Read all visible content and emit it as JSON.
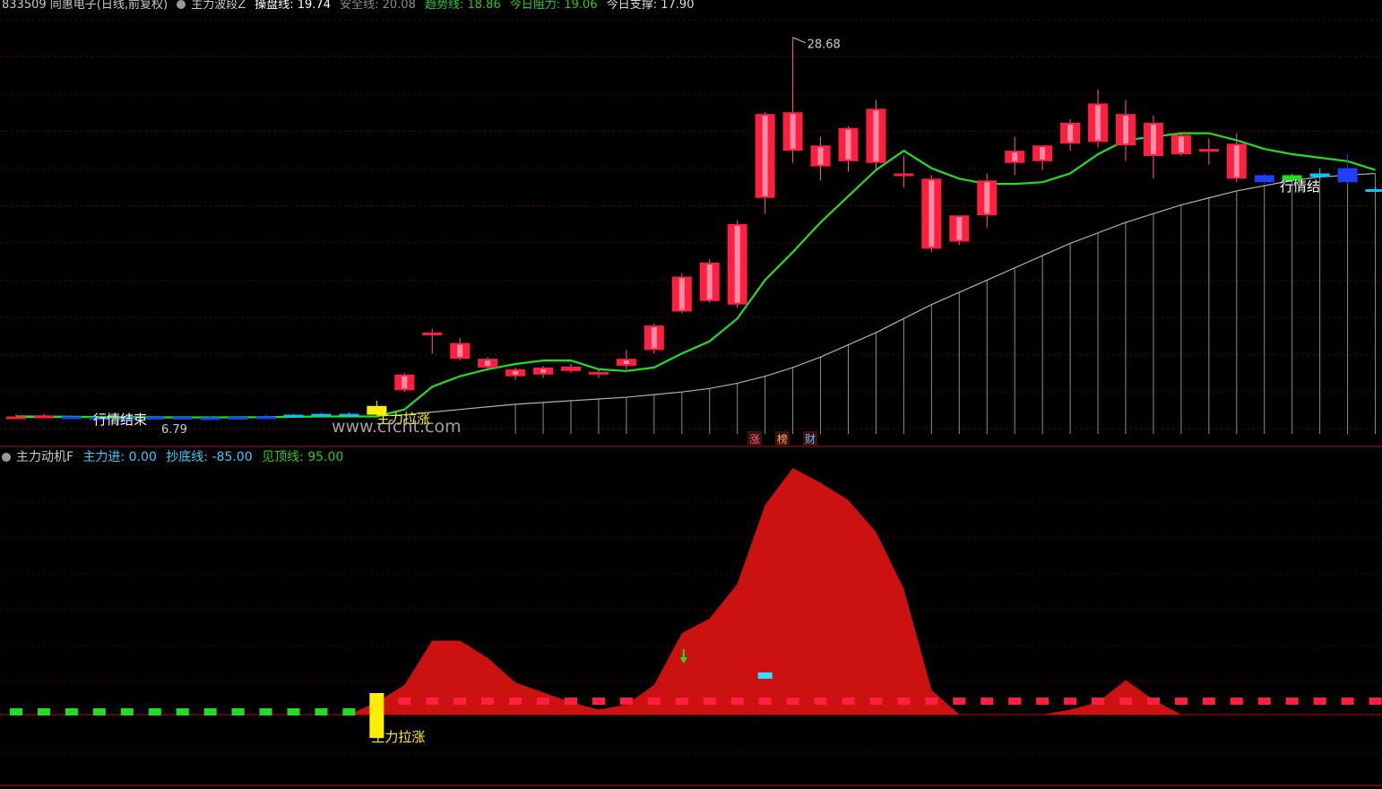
{
  "header": {
    "stock": "833509 同惠电子(日线,前复权)",
    "indicator": "主力波段Z",
    "items": [
      {
        "label": "操盘线: 19.74",
        "color": "#ffffff"
      },
      {
        "label": "安全线: 20.08",
        "color": "#8a8a8a"
      },
      {
        "label": "趋势线: 18.86",
        "color": "#22cc22"
      },
      {
        "label": "今日阻力: 19.06",
        "color": "#22cc22"
      },
      {
        "label": "今日支撑: 17.90",
        "color": "#dddddd"
      }
    ]
  },
  "sub_header": {
    "indicator": "主力动机F",
    "items": [
      {
        "label": "主力进: 0.00",
        "color": "#33ccff"
      },
      {
        "label": "抄底线: -85.00",
        "color": "#33ccff"
      },
      {
        "label": "见顶线: 95.00",
        "color": "#22cc22"
      }
    ]
  },
  "watermark": "www.cfcht.com",
  "colors": {
    "up": "#ff1f3f",
    "down": "#00d0ff",
    "trend": "#22dd22",
    "safe": "#b0b0b0",
    "fill": "#cc1111"
  },
  "chart_data": [
    {
      "type": "candlestick",
      "ylim": [
        6.0,
        30.0
      ],
      "high_label": "28.68",
      "low_label": "6.79",
      "annotations": [
        "行情结束",
        "主力拉涨",
        "行情结",
        "涨",
        "榜",
        "财"
      ],
      "candles": [
        {
          "o": 6.95,
          "h": 7.1,
          "l": 6.85,
          "c": 7.0,
          "col": "red"
        },
        {
          "o": 7.0,
          "h": 7.15,
          "l": 6.9,
          "c": 7.05,
          "col": "red"
        },
        {
          "o": 7.0,
          "h": 7.1,
          "l": 6.9,
          "c": 6.95,
          "col": "blue"
        },
        {
          "o": 6.95,
          "h": 7.05,
          "l": 6.85,
          "c": 6.92,
          "col": "blue"
        },
        {
          "o": 6.92,
          "h": 7.0,
          "l": 6.85,
          "c": 6.95,
          "col": "blue"
        },
        {
          "o": 6.95,
          "h": 7.05,
          "l": 6.88,
          "c": 6.97,
          "col": "blue"
        },
        {
          "o": 6.97,
          "h": 7.05,
          "l": 6.9,
          "c": 6.92,
          "col": "blue"
        },
        {
          "o": 6.92,
          "h": 7.0,
          "l": 6.85,
          "c": 6.95,
          "col": "blue"
        },
        {
          "o": 6.95,
          "h": 7.05,
          "l": 6.88,
          "c": 6.97,
          "col": "blue"
        },
        {
          "o": 6.97,
          "h": 7.1,
          "l": 6.9,
          "c": 7.0,
          "col": "blue"
        },
        {
          "o": 6.95,
          "h": 7.15,
          "l": 6.9,
          "c": 7.1,
          "col": "cyan"
        },
        {
          "o": 7.0,
          "h": 7.2,
          "l": 6.95,
          "c": 7.15,
          "col": "cyan"
        },
        {
          "o": 7.05,
          "h": 7.25,
          "l": 7.0,
          "c": 7.15,
          "col": "cyan"
        },
        {
          "o": 7.1,
          "h": 7.9,
          "l": 7.05,
          "c": 7.6,
          "col": "yellow"
        },
        {
          "o": 8.5,
          "h": 9.5,
          "l": 8.4,
          "c": 9.4,
          "col": "red"
        },
        {
          "o": 11.8,
          "h": 12.0,
          "l": 10.6,
          "c": 11.7,
          "col": "red"
        },
        {
          "o": 10.3,
          "h": 11.5,
          "l": 10.2,
          "c": 11.2,
          "col": "red"
        },
        {
          "o": 9.8,
          "h": 10.4,
          "l": 9.6,
          "c": 10.3,
          "col": "red"
        },
        {
          "o": 9.3,
          "h": 9.8,
          "l": 9.1,
          "c": 9.7,
          "col": "red"
        },
        {
          "o": 9.4,
          "h": 9.9,
          "l": 9.2,
          "c": 9.8,
          "col": "red"
        },
        {
          "o": 9.6,
          "h": 10.0,
          "l": 9.5,
          "c": 9.85,
          "col": "red"
        },
        {
          "o": 9.5,
          "h": 9.7,
          "l": 9.2,
          "c": 9.55,
          "col": "red"
        },
        {
          "o": 9.9,
          "h": 10.8,
          "l": 9.7,
          "c": 10.3,
          "col": "red"
        },
        {
          "o": 10.8,
          "h": 12.3,
          "l": 10.6,
          "c": 12.2,
          "col": "red"
        },
        {
          "o": 13.0,
          "h": 15.2,
          "l": 12.9,
          "c": 15.0,
          "col": "red"
        },
        {
          "o": 13.6,
          "h": 16.0,
          "l": 13.5,
          "c": 15.8,
          "col": "red"
        },
        {
          "o": 13.4,
          "h": 18.2,
          "l": 13.2,
          "c": 18.0,
          "col": "red"
        },
        {
          "o": 19.5,
          "h": 24.4,
          "l": 18.6,
          "c": 24.3,
          "col": "red"
        },
        {
          "o": 22.2,
          "h": 28.68,
          "l": 21.5,
          "c": 24.4,
          "col": "red"
        },
        {
          "o": 21.3,
          "h": 23.0,
          "l": 20.5,
          "c": 22.5,
          "col": "red"
        },
        {
          "o": 21.6,
          "h": 23.6,
          "l": 21.0,
          "c": 23.5,
          "col": "red"
        },
        {
          "o": 21.5,
          "h": 25.1,
          "l": 21.1,
          "c": 24.6,
          "col": "red"
        },
        {
          "o": 20.8,
          "h": 21.9,
          "l": 20.1,
          "c": 20.9,
          "col": "red"
        },
        {
          "o": 16.6,
          "h": 20.8,
          "l": 16.4,
          "c": 20.6,
          "col": "red"
        },
        {
          "o": 17.0,
          "h": 18.5,
          "l": 16.8,
          "c": 18.5,
          "col": "red"
        },
        {
          "o": 18.5,
          "h": 20.9,
          "l": 17.8,
          "c": 20.5,
          "col": "red"
        },
        {
          "o": 21.5,
          "h": 23.0,
          "l": 20.8,
          "c": 22.2,
          "col": "red"
        },
        {
          "o": 21.6,
          "h": 22.5,
          "l": 21.1,
          "c": 22.5,
          "col": "red"
        },
        {
          "o": 22.6,
          "h": 24.0,
          "l": 22.2,
          "c": 23.8,
          "col": "red"
        },
        {
          "o": 22.7,
          "h": 25.7,
          "l": 22.4,
          "c": 24.9,
          "col": "red"
        },
        {
          "o": 22.5,
          "h": 25.1,
          "l": 21.6,
          "c": 24.3,
          "col": "red"
        },
        {
          "o": 21.9,
          "h": 24.2,
          "l": 20.6,
          "c": 23.8,
          "col": "red"
        },
        {
          "o": 22.0,
          "h": 23.2,
          "l": 21.9,
          "c": 23.1,
          "col": "red"
        },
        {
          "o": 22.2,
          "h": 22.9,
          "l": 21.4,
          "c": 22.3,
          "col": "red"
        },
        {
          "o": 20.6,
          "h": 23.2,
          "l": 20.4,
          "c": 22.6,
          "col": "red"
        },
        {
          "o": 20.8,
          "h": 20.9,
          "l": 20.3,
          "c": 20.4,
          "col": "blue"
        },
        {
          "o": 20.5,
          "h": 20.9,
          "l": 20.4,
          "c": 20.8,
          "col": "green"
        },
        {
          "o": 20.7,
          "h": 21.2,
          "l": 20.5,
          "c": 20.9,
          "col": "cyan"
        },
        {
          "o": 21.2,
          "h": 22.0,
          "l": 20.3,
          "c": 20.4,
          "col": "blue"
        },
        {
          "o": 20.0,
          "h": 20.2,
          "l": 19.8,
          "c": 19.9,
          "col": "cyan"
        }
      ],
      "trend_line": [
        7.0,
        7.0,
        6.98,
        6.97,
        6.96,
        6.95,
        6.95,
        6.95,
        6.95,
        6.96,
        6.98,
        7.0,
        7.0,
        7.0,
        7.4,
        8.7,
        9.3,
        9.7,
        10.0,
        10.2,
        10.2,
        9.7,
        9.6,
        9.8,
        10.6,
        11.3,
        12.6,
        14.8,
        16.4,
        18.1,
        19.6,
        21.1,
        22.2,
        21.2,
        20.6,
        20.3,
        20.3,
        20.4,
        20.9,
        22.0,
        22.8,
        23.0,
        23.2,
        23.2,
        22.8,
        22.3,
        22.0,
        21.8,
        21.6,
        21.1
      ],
      "safe_line": [
        6.95,
        6.95,
        6.95,
        6.95,
        6.95,
        6.95,
        6.95,
        6.95,
        6.95,
        6.95,
        6.97,
        6.98,
        7.0,
        7.02,
        7.1,
        7.25,
        7.4,
        7.55,
        7.7,
        7.8,
        7.9,
        8.0,
        8.1,
        8.25,
        8.4,
        8.6,
        8.9,
        9.3,
        9.8,
        10.4,
        11.1,
        11.8,
        12.6,
        13.4,
        14.1,
        14.8,
        15.5,
        16.2,
        16.9,
        17.5,
        18.1,
        18.6,
        19.1,
        19.5,
        19.9,
        20.2,
        20.5,
        20.7,
        20.8,
        20.9
      ]
    },
    {
      "type": "area",
      "title": "主力动机F",
      "ylim": [
        -30,
        100
      ],
      "values": [
        0,
        0,
        0,
        0,
        0,
        0,
        0,
        0,
        0,
        0,
        0,
        0,
        0,
        5,
        12,
        30,
        30,
        23,
        13,
        9,
        5,
        2,
        4,
        12,
        33,
        39,
        53,
        85,
        100,
        94,
        87,
        74,
        51,
        10,
        0,
        0,
        0,
        0,
        2,
        5,
        14,
        6,
        0,
        0,
        0,
        0,
        0,
        0,
        0,
        0
      ],
      "signal_labels": [
        "主力拉涨"
      ],
      "buy_arrow_index": 24,
      "marker_index": 27
    }
  ]
}
